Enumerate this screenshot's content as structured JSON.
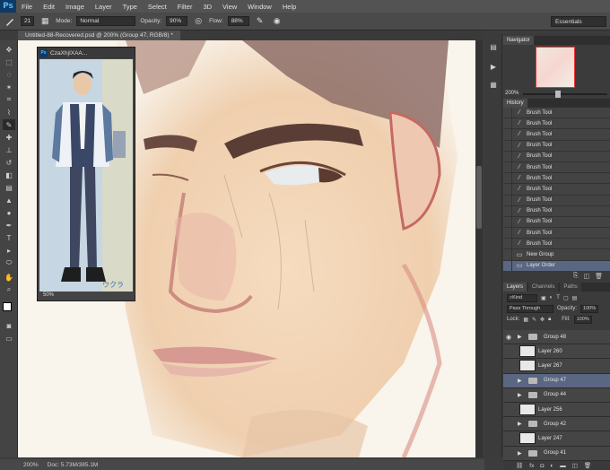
{
  "app": {
    "logo": "Ps"
  },
  "menus": [
    "File",
    "Edit",
    "Image",
    "Layer",
    "Type",
    "Select",
    "Filter",
    "3D",
    "View",
    "Window",
    "Help"
  ],
  "options": {
    "brush_size": "21",
    "mode_label": "Mode:",
    "mode_value": "Normal",
    "opacity_label": "Opacity:",
    "opacity_value": "90%",
    "flow_label": "Flow:",
    "flow_value": "88%",
    "workspace": "Essentials"
  },
  "document": {
    "tab_title": "Untitled-88-Recovered.psd @ 200% (Group 47, RGB/8) *",
    "zoom": "200%",
    "doc_info": "Doc: 5.73M/385.1M"
  },
  "reference_window": {
    "title": "CzaXhjIXAA...",
    "zoom": "50%"
  },
  "navigator": {
    "title": "Navigator",
    "zoom": "200%"
  },
  "history": {
    "title": "History",
    "items": [
      {
        "label": "Brush Tool",
        "icon": "brush-icon"
      },
      {
        "label": "Brush Tool",
        "icon": "brush-icon"
      },
      {
        "label": "Brush Tool",
        "icon": "brush-icon"
      },
      {
        "label": "Brush Tool",
        "icon": "brush-icon"
      },
      {
        "label": "Brush Tool",
        "icon": "brush-icon"
      },
      {
        "label": "Brush Tool",
        "icon": "brush-icon"
      },
      {
        "label": "Brush Tool",
        "icon": "brush-icon"
      },
      {
        "label": "Brush Tool",
        "icon": "brush-icon"
      },
      {
        "label": "Brush Tool",
        "icon": "brush-icon"
      },
      {
        "label": "Brush Tool",
        "icon": "brush-icon"
      },
      {
        "label": "Brush Tool",
        "icon": "brush-icon"
      },
      {
        "label": "Brush Tool",
        "icon": "brush-icon"
      },
      {
        "label": "Brush Tool",
        "icon": "brush-icon"
      },
      {
        "label": "New Group",
        "icon": "folder-icon"
      },
      {
        "label": "Layer Order",
        "icon": "folder-icon"
      }
    ]
  },
  "layers": {
    "tabs": [
      "Layers",
      "Channels",
      "Paths"
    ],
    "kind_label": "Kind",
    "blend_mode": "Pass Through",
    "opacity_label": "Opacity:",
    "opacity_value": "100%",
    "lock_label": "Lock:",
    "fill_label": "Fill:",
    "fill_value": "100%",
    "items": [
      {
        "name": "Group 48",
        "type": "group"
      },
      {
        "name": "Layer 260",
        "type": "layer"
      },
      {
        "name": "Layer 267",
        "type": "layer"
      },
      {
        "name": "Group 47",
        "type": "group"
      },
      {
        "name": "Group 44",
        "type": "group"
      },
      {
        "name": "Layer 256",
        "type": "layer"
      },
      {
        "name": "Group 42",
        "type": "group"
      },
      {
        "name": "Layer 247",
        "type": "layer"
      },
      {
        "name": "Group 41",
        "type": "group"
      }
    ]
  }
}
